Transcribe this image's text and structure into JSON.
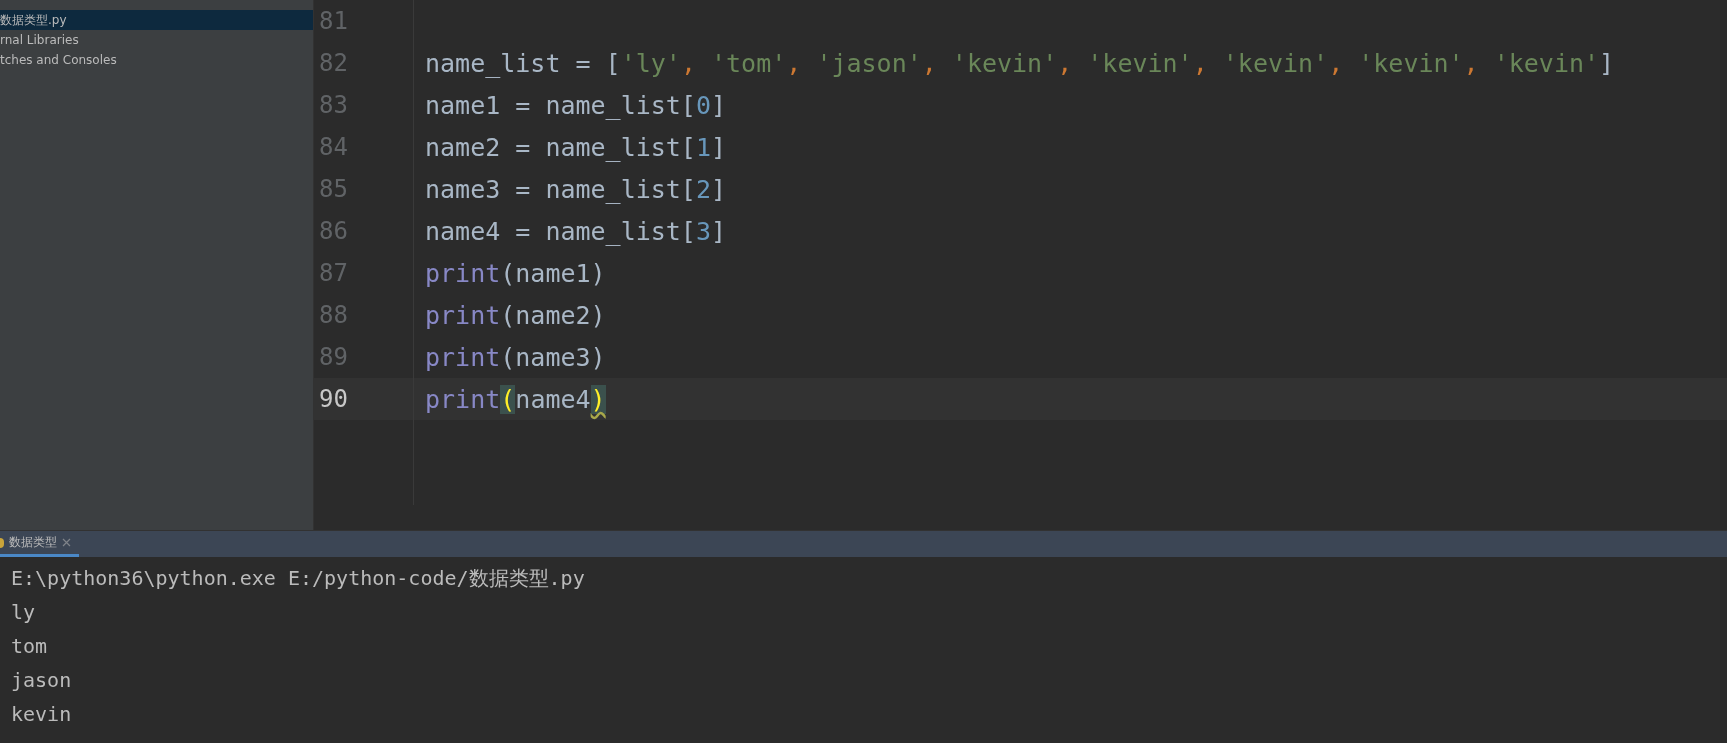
{
  "sidebar": {
    "items": [
      {
        "label": "数据类型.py",
        "selected": true
      },
      {
        "label": "rnal Libraries",
        "selected": false
      },
      {
        "label": "tches and Consoles",
        "selected": false
      }
    ]
  },
  "editor": {
    "lines": [
      {
        "number": "81",
        "current": false
      },
      {
        "number": "82",
        "current": false,
        "tokens": [
          {
            "kind": "plain",
            "text": "name_list = ["
          },
          {
            "kind": "string",
            "text": "'ly'"
          },
          {
            "kind": "comma",
            "text": ", "
          },
          {
            "kind": "string",
            "text": "'tom'"
          },
          {
            "kind": "comma",
            "text": ", "
          },
          {
            "kind": "string",
            "text": "'jason'"
          },
          {
            "kind": "comma",
            "text": ", "
          },
          {
            "kind": "string",
            "text": "'kevin'"
          },
          {
            "kind": "comma",
            "text": ", "
          },
          {
            "kind": "string",
            "text": "'kevin'"
          },
          {
            "kind": "comma",
            "text": ", "
          },
          {
            "kind": "string",
            "text": "'kevin'"
          },
          {
            "kind": "comma",
            "text": ", "
          },
          {
            "kind": "string",
            "text": "'kevin'"
          },
          {
            "kind": "comma",
            "text": ", "
          },
          {
            "kind": "string",
            "text": "'kevin'"
          },
          {
            "kind": "plain",
            "text": "]"
          }
        ]
      },
      {
        "number": "83",
        "current": false,
        "tokens": [
          {
            "kind": "plain",
            "text": "name1 = name_list["
          },
          {
            "kind": "number",
            "text": "0"
          },
          {
            "kind": "plain",
            "text": "]"
          }
        ]
      },
      {
        "number": "84",
        "current": false,
        "tokens": [
          {
            "kind": "plain",
            "text": "name2 = name_list["
          },
          {
            "kind": "number",
            "text": "1"
          },
          {
            "kind": "plain",
            "text": "]"
          }
        ]
      },
      {
        "number": "85",
        "current": false,
        "tokens": [
          {
            "kind": "plain",
            "text": "name3 = name_list["
          },
          {
            "kind": "number",
            "text": "2"
          },
          {
            "kind": "plain",
            "text": "]"
          }
        ]
      },
      {
        "number": "86",
        "current": false,
        "tokens": [
          {
            "kind": "plain",
            "text": "name4 = name_list["
          },
          {
            "kind": "number",
            "text": "3"
          },
          {
            "kind": "plain",
            "text": "]"
          }
        ]
      },
      {
        "number": "87",
        "current": false,
        "tokens": [
          {
            "kind": "builtin",
            "text": "print"
          },
          {
            "kind": "plain",
            "text": "(name1)"
          }
        ]
      },
      {
        "number": "88",
        "current": false,
        "tokens": [
          {
            "kind": "builtin",
            "text": "print"
          },
          {
            "kind": "plain",
            "text": "(name2)"
          }
        ]
      },
      {
        "number": "89",
        "current": false,
        "tokens": [
          {
            "kind": "builtin",
            "text": "print"
          },
          {
            "kind": "plain",
            "text": "(name3)"
          }
        ]
      },
      {
        "number": "90",
        "current": true,
        "tokens": [
          {
            "kind": "builtin",
            "text": "print"
          },
          {
            "kind": "brace",
            "text": "("
          },
          {
            "kind": "plain",
            "text": "name4"
          },
          {
            "kind": "brace_warning",
            "text": ")"
          }
        ]
      }
    ]
  },
  "run_panel": {
    "tab": {
      "label": "数据类型",
      "selected": true
    },
    "output": [
      "E:\\python36\\python.exe E:/python-code/数据类型.py",
      "ly",
      "tom",
      "jason",
      "kevin"
    ]
  }
}
